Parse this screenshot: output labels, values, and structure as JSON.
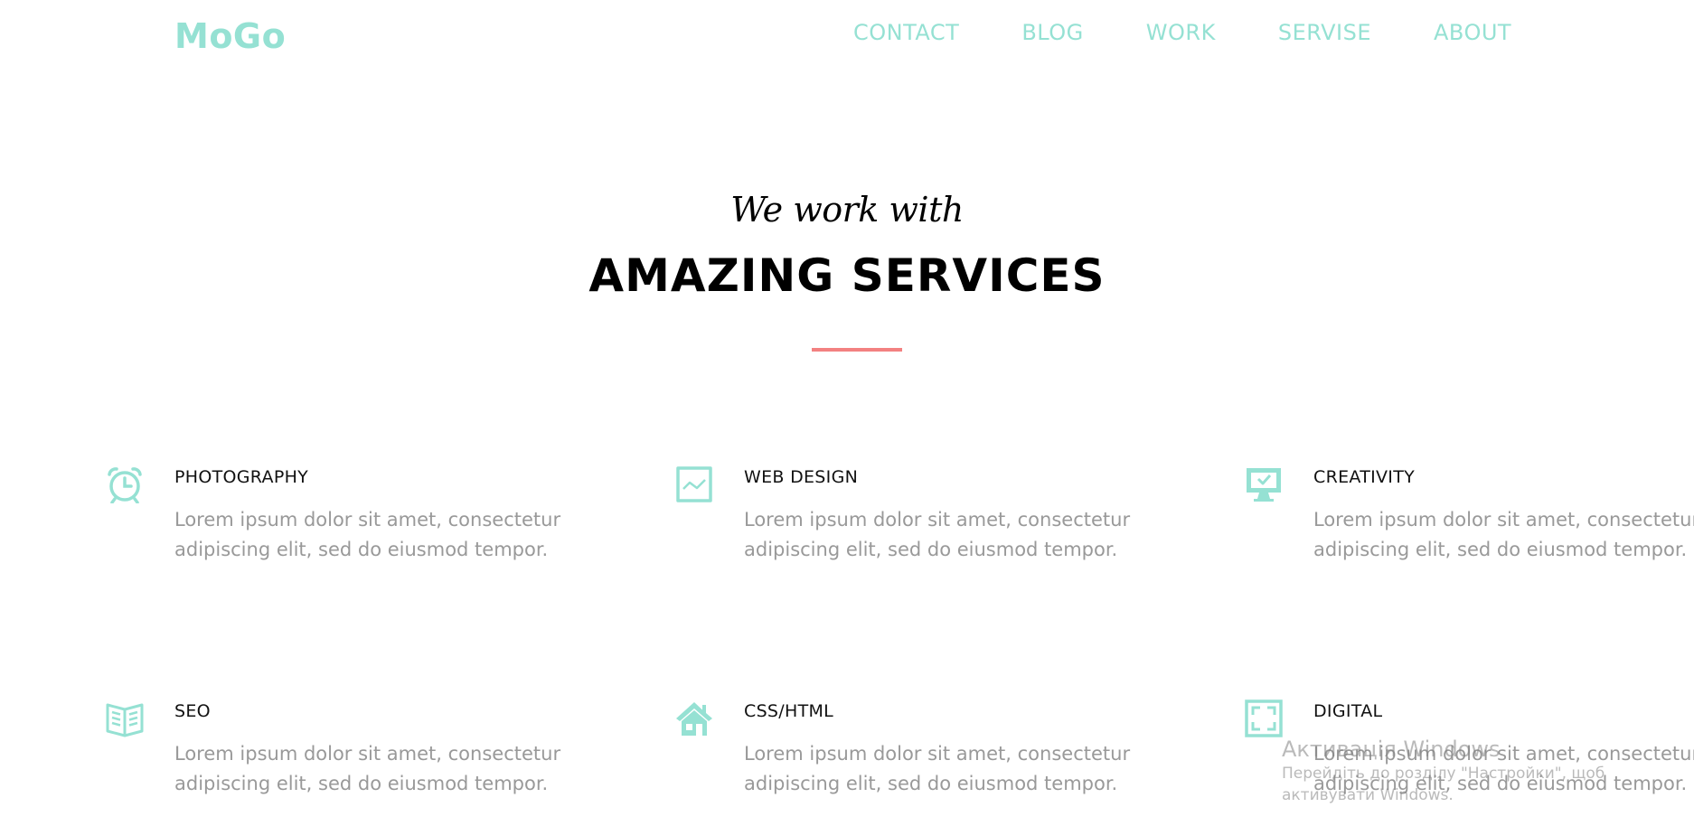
{
  "header": {
    "logo": "MoGo",
    "nav": [
      "CONTACT",
      "BLOG",
      "WORK",
      "SERVISE",
      "ABOUT"
    ]
  },
  "hero": {
    "subtitle": "We work with",
    "title": "AMAZING SERVICES"
  },
  "services": [
    {
      "title": "PHOTOGRAPHY",
      "icon": "alarm-clock-icon",
      "desc": "Lorem ipsum dolor sit amet, consectetur adipiscing elit, sed do eiusmod tempor."
    },
    {
      "title": "WEB DESIGN",
      "icon": "line-chart-icon",
      "desc": "Lorem ipsum dolor sit amet, consectetur adipiscing elit, sed do eiusmod tempor."
    },
    {
      "title": "CREATIVITY",
      "icon": "monitor-icon",
      "desc": "Lorem ipsum dolor sit amet, consectetur adipiscing elit, sed do eiusmod tempor."
    },
    {
      "title": "SEO",
      "icon": "book-icon",
      "desc": "Lorem ipsum dolor sit amet, consectetur adipiscing elit, sed do eiusmod tempor."
    },
    {
      "title": "CSS/HTML",
      "icon": "house-icon",
      "desc": "Lorem ipsum dolor sit amet, consectetur adipiscing elit, sed do eiusmod tempor."
    },
    {
      "title": "DIGITAL",
      "icon": "fullscreen-icon",
      "desc": "Lorem ipsum dolor sit amet, consectetur adipiscing elit, sed do eiusmod tempor."
    }
  ],
  "watermark": {
    "title": "Активація Windows",
    "subtitle": "Перейдіть до розділу \"Настройки\", щоб активувати Windows."
  },
  "colors": {
    "accent": "#95e1d3",
    "divider": "#f38181",
    "text": "#111111",
    "muted": "#999999"
  }
}
